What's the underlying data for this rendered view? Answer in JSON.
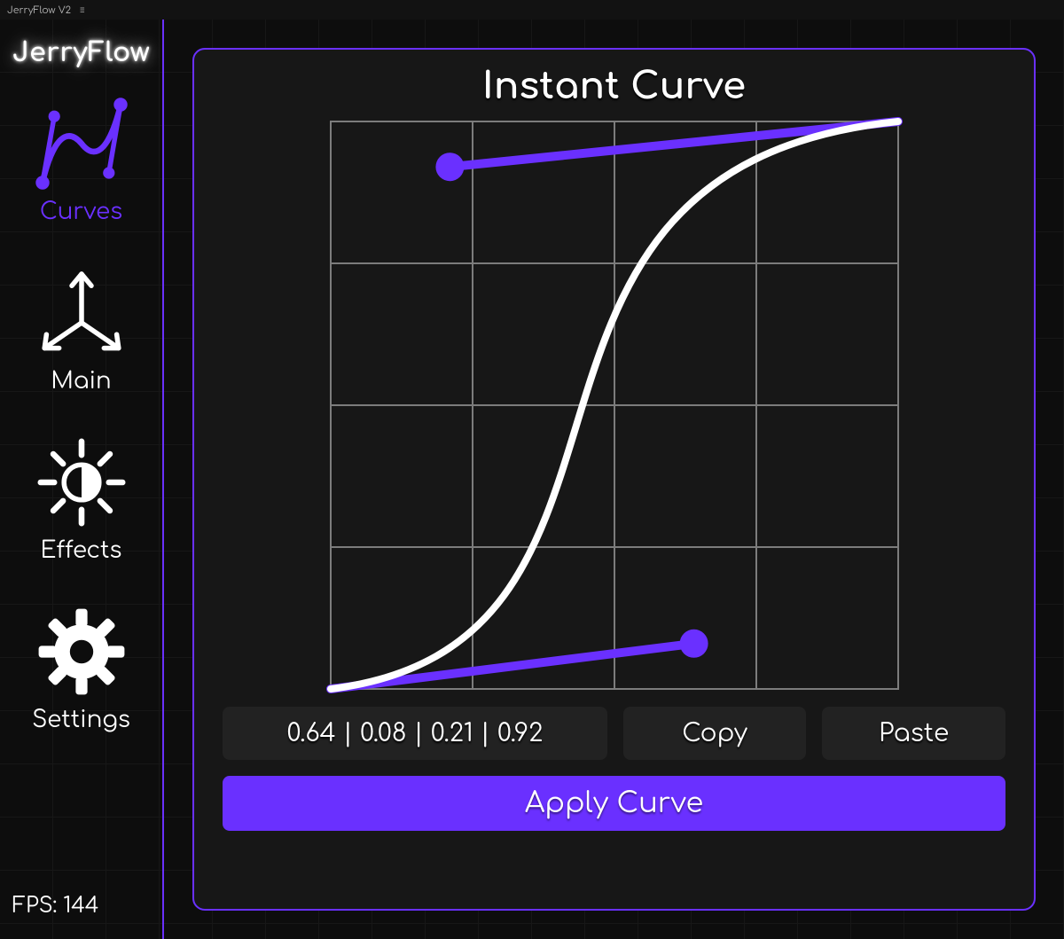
{
  "window": {
    "title": "JerryFlow V2"
  },
  "app": {
    "logo": "JerryFlow"
  },
  "sidebar": {
    "items": [
      {
        "id": "curves",
        "label": "Curves",
        "active": true
      },
      {
        "id": "main",
        "label": "Main",
        "active": false
      },
      {
        "id": "effects",
        "label": "Effects",
        "active": false
      },
      {
        "id": "settings",
        "label": "Settings",
        "active": false
      }
    ],
    "fps_label": "FPS: 144",
    "fps_value": 144
  },
  "panel": {
    "title": "Instant Curve",
    "bezier": {
      "p1x": 0.64,
      "p1y": 0.08,
      "p2x": 0.21,
      "p2y": 0.92
    },
    "bezier_display": "0.64 | 0.08 | 0.21 | 0.92",
    "copy_label": "Copy",
    "paste_label": "Paste",
    "apply_label": "Apply Curve"
  },
  "colors": {
    "accent": "#6a30ff",
    "background": "#0d0d0d"
  }
}
